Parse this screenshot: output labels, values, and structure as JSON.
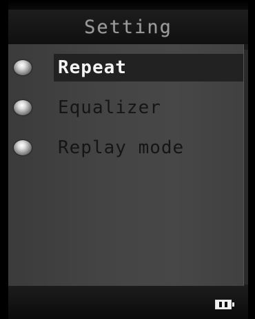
{
  "header": {
    "title": "Setting"
  },
  "menu": {
    "items": [
      {
        "label": "Repeat",
        "selected": true
      },
      {
        "label": "Equalizer",
        "selected": false
      },
      {
        "label": "Replay mode",
        "selected": false
      }
    ]
  },
  "status": {
    "battery_icon": "battery-icon"
  },
  "colors": {
    "selection_bg": "#222222",
    "content_bg": "#444444",
    "title_text": "#9a9a9a"
  }
}
